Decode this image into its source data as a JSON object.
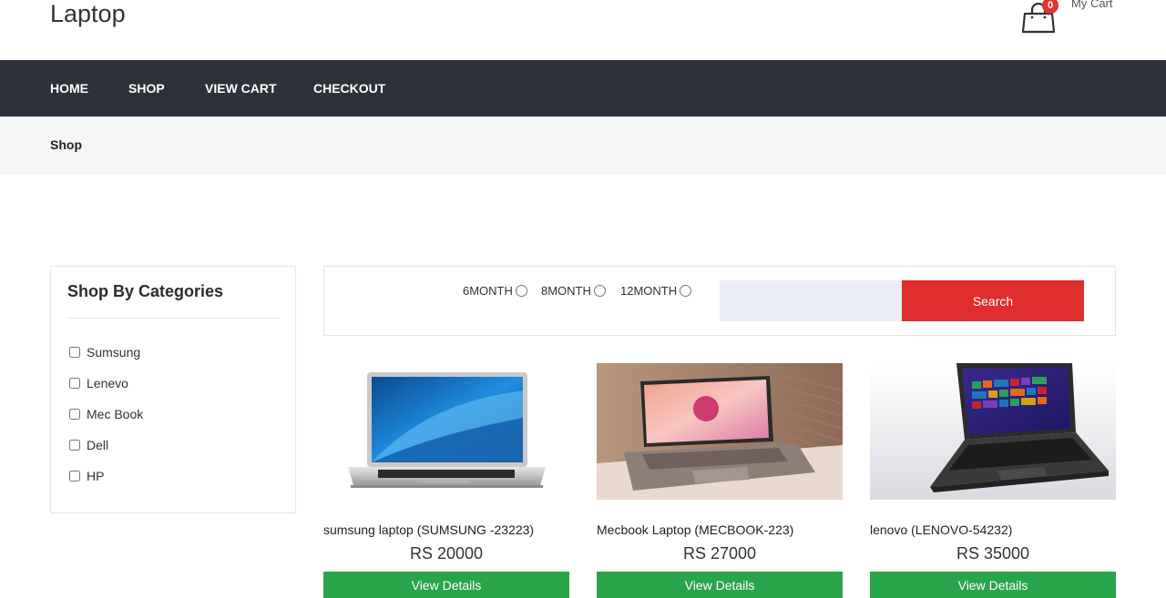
{
  "header": {
    "site_title": "Laptop",
    "cart_label": "My Cart",
    "cart_count": "0"
  },
  "nav": {
    "items": [
      {
        "label": "HOME"
      },
      {
        "label": "SHOP"
      },
      {
        "label": "VIEW CART"
      },
      {
        "label": "CHECKOUT"
      }
    ]
  },
  "breadcrumb": "Shop",
  "sidebar": {
    "title": "Shop By Categories",
    "categories": [
      {
        "label": "Sumsung"
      },
      {
        "label": "Lenevo"
      },
      {
        "label": "Mec Book"
      },
      {
        "label": "Dell"
      },
      {
        "label": "HP"
      }
    ]
  },
  "filter": {
    "options": [
      {
        "label": "6MONTH"
      },
      {
        "label": "8MONTH"
      },
      {
        "label": "12MONTH"
      }
    ],
    "search_value": "",
    "search_button": "Search"
  },
  "products": [
    {
      "name": "sumsung laptop (SUMSUNG -23223)",
      "price": "RS 20000",
      "button": "View Details"
    },
    {
      "name": "Mecbook Laptop (MECBOOK-223)",
      "price": "RS 27000",
      "button": "View Details"
    },
    {
      "name": "lenovo (LENOVO-54232)",
      "price": "RS 35000",
      "button": "View Details"
    }
  ],
  "colors": {
    "nav_bg": "#2e3139",
    "search_button": "#e02d2d",
    "view_details": "#2aa44a",
    "cart_badge": "#e3342f"
  }
}
